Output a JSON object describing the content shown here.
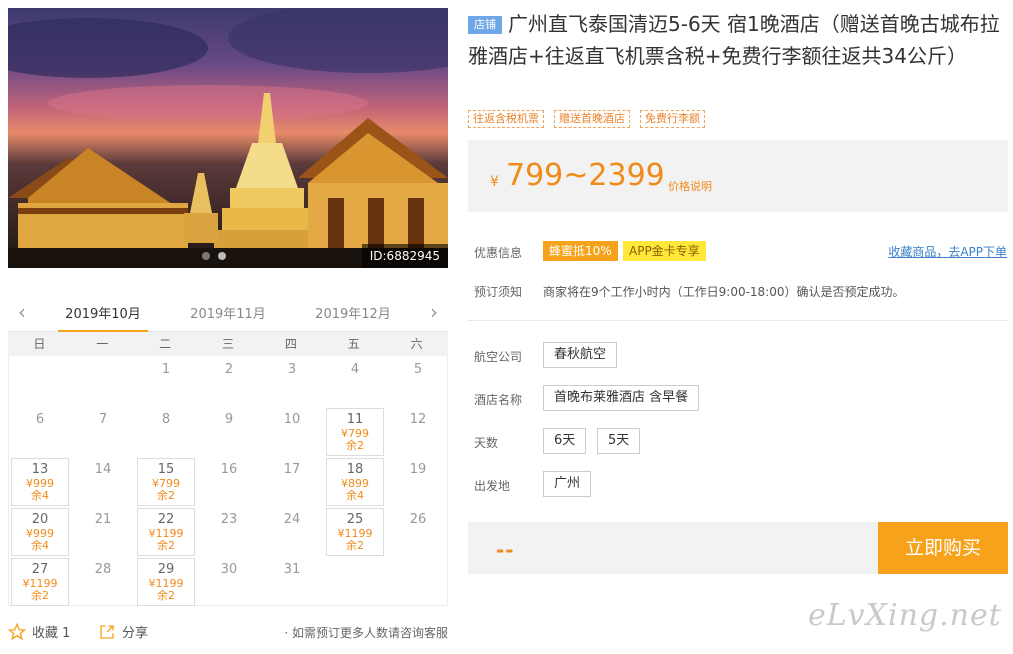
{
  "photo": {
    "id_label": "ID:6882945"
  },
  "calendar": {
    "months": [
      "2019年10月",
      "2019年11月",
      "2019年12月"
    ],
    "weekdays": [
      "日",
      "一",
      "二",
      "三",
      "四",
      "五",
      "六"
    ],
    "days": [
      {
        "n": "1"
      },
      {
        "n": "2"
      },
      {
        "n": "3"
      },
      {
        "n": "4"
      },
      {
        "n": "5"
      },
      {
        "n": "6"
      },
      {
        "n": "7"
      },
      {
        "n": "8"
      },
      {
        "n": "9"
      },
      {
        "n": "10"
      },
      {
        "n": "11",
        "price": "¥799",
        "left": "余2"
      },
      {
        "n": "12"
      },
      {
        "n": "13",
        "price": "¥999",
        "left": "余4"
      },
      {
        "n": "14"
      },
      {
        "n": "15",
        "price": "¥799",
        "left": "余2"
      },
      {
        "n": "16"
      },
      {
        "n": "17"
      },
      {
        "n": "18",
        "price": "¥899",
        "left": "余4"
      },
      {
        "n": "19"
      },
      {
        "n": "20",
        "price": "¥999",
        "left": "余4"
      },
      {
        "n": "21"
      },
      {
        "n": "22",
        "price": "¥1199",
        "left": "余2"
      },
      {
        "n": "23"
      },
      {
        "n": "24"
      },
      {
        "n": "25",
        "price": "¥1199",
        "left": "余2"
      },
      {
        "n": "26"
      },
      {
        "n": "27",
        "price": "¥1199",
        "left": "余2"
      },
      {
        "n": "28"
      },
      {
        "n": "29",
        "price": "¥1199",
        "left": "余2"
      },
      {
        "n": "30"
      },
      {
        "n": "31"
      }
    ]
  },
  "footer": {
    "favorite": "收藏 1",
    "share": "分享",
    "note": "· 如需预订更多人数请咨询客服"
  },
  "product": {
    "shop_badge": "店铺",
    "title": "广州直飞泰国清迈5-6天 宿1晚酒店（赠送首晚古城布拉雅酒店+往返直飞机票含税+免费行李额往返共34公斤）",
    "tags": [
      "往返含税机票",
      "赠送首晚酒店",
      "免费行李额"
    ],
    "price_symbol": "¥",
    "price_range": "799~2399",
    "price_note": "价格说明"
  },
  "offers": {
    "label": "优惠信息",
    "promo1": "蜂蜜抵10%",
    "promo2": "APP金卡专享",
    "app_link": "收藏商品，去APP下单"
  },
  "booking": {
    "label": "预订须知",
    "text": "商家将在9个工作小时内（工作日9:00-18:00）确认是否预定成功。"
  },
  "options": {
    "airline_label": "航空公司",
    "airline": "春秋航空",
    "hotel_label": "酒店名称",
    "hotel": "首晚布莱雅酒店 含早餐",
    "days_label": "天数",
    "days": [
      "6天",
      "5天"
    ],
    "depart_label": "出发地",
    "depart": "广州"
  },
  "buy": {
    "total": "--",
    "button": "立即购买"
  },
  "watermark": "eLvXing.net",
  "colors": {
    "accent": "#f7a21b",
    "price": "#f08b1a",
    "link": "#3a7fc8",
    "shop_badge": "#6fa6e8"
  }
}
